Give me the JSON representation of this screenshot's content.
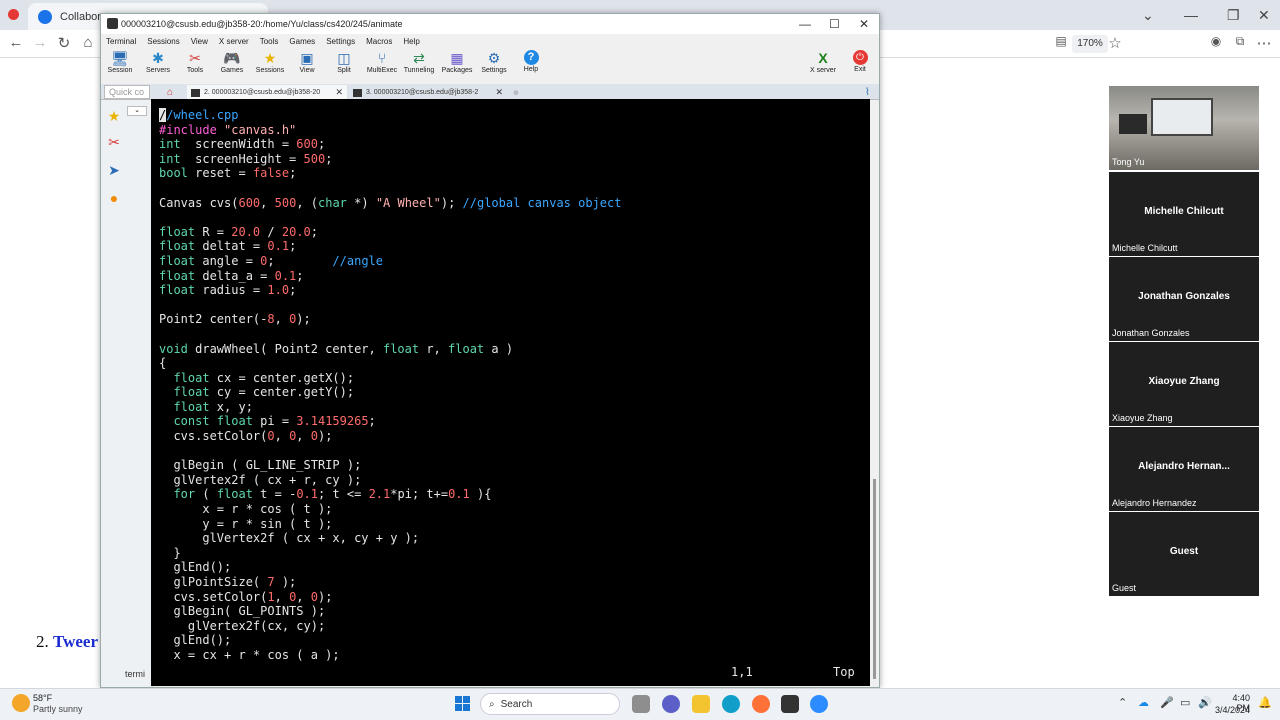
{
  "browser": {
    "tab_label": "Collaborate",
    "zoom": "170%"
  },
  "webpage": {
    "tween_number": "2.",
    "tween_text": "Tweer"
  },
  "participants": {
    "video_name": "Tong Yu",
    "list": [
      {
        "display": "Michelle Chilcutt",
        "label": "Michelle Chilcutt"
      },
      {
        "display": "Jonathan Gonzales",
        "label": "Jonathan Gonzales"
      },
      {
        "display": "Xiaoyue Zhang",
        "label": "Xiaoyue Zhang"
      },
      {
        "display": "Alejandro  Hernan...",
        "label": "Alejandro Hernandez"
      },
      {
        "display": "Guest",
        "label": "Guest"
      }
    ]
  },
  "moba": {
    "title": "000003210@csusb.edu@jb358-20:/home/Yu/class/cs420/245/animate",
    "menu": [
      "Terminal",
      "Sessions",
      "View",
      "X server",
      "Tools",
      "Games",
      "Settings",
      "Macros",
      "Help"
    ],
    "tools": [
      {
        "label": "Session",
        "icon": "session-icon",
        "glyph": "🖥"
      },
      {
        "label": "Servers",
        "icon": "servers-icon",
        "glyph": "✱"
      },
      {
        "label": "Tools",
        "icon": "tools-icon",
        "glyph": "✂"
      },
      {
        "label": "Games",
        "icon": "games-icon",
        "glyph": "🎮"
      },
      {
        "label": "Sessions",
        "icon": "sessions-star-icon",
        "glyph": "★"
      },
      {
        "label": "View",
        "icon": "view-icon",
        "glyph": "▣"
      },
      {
        "label": "Split",
        "icon": "split-icon",
        "glyph": "◫"
      },
      {
        "label": "MultiExec",
        "icon": "multiexec-icon",
        "glyph": "⑂"
      },
      {
        "label": "Tunneling",
        "icon": "tunneling-icon",
        "glyph": "⇄"
      },
      {
        "label": "Packages",
        "icon": "packages-icon",
        "glyph": "▦"
      },
      {
        "label": "Settings",
        "icon": "settings-icon",
        "glyph": "⚙"
      },
      {
        "label": "Help",
        "icon": "help-icon",
        "glyph": "?"
      }
    ],
    "xserver_label": "X server",
    "exit_label": "Exit",
    "quick_connect": "Quick co",
    "tab1": "2. 000003210@csusb.edu@jb358-20",
    "tab2": "3. 000003210@csusb.edu@jb358-2",
    "side_label": "termi",
    "status_pos": "1,1",
    "status_top": "Top"
  },
  "code_lines": [
    [
      [
        "cur",
        "/"
      ],
      [
        "cm",
        "/wheel.cpp"
      ]
    ],
    [
      [
        "pp",
        "#include "
      ],
      [
        "str",
        "\"canvas.h\""
      ]
    ],
    [
      [
        "kw",
        "int"
      ],
      [
        "",
        "  screenWidth = "
      ],
      [
        "num",
        "600"
      ],
      [
        "",
        ";"
      ]
    ],
    [
      [
        "kw",
        "int"
      ],
      [
        "",
        "  screenHeight = "
      ],
      [
        "num",
        "500"
      ],
      [
        "",
        ";"
      ]
    ],
    [
      [
        "kw",
        "bool"
      ],
      [
        "",
        " reset = "
      ],
      [
        "num",
        "false"
      ],
      [
        "",
        ";"
      ]
    ],
    [],
    [
      [
        "",
        "Canvas cvs("
      ],
      [
        "num",
        "600"
      ],
      [
        "",
        ", "
      ],
      [
        "num",
        "500"
      ],
      [
        "",
        ", ("
      ],
      [
        "kw",
        "char"
      ],
      [
        "",
        " *) "
      ],
      [
        "str",
        "\"A Wheel\""
      ],
      [
        "",
        "); "
      ],
      [
        "cm",
        "//global canvas object"
      ]
    ],
    [],
    [
      [
        "kw",
        "float"
      ],
      [
        "",
        " R = "
      ],
      [
        "num",
        "20.0"
      ],
      [
        "",
        " / "
      ],
      [
        "num",
        "20.0"
      ],
      [
        "",
        ";"
      ]
    ],
    [
      [
        "kw",
        "float"
      ],
      [
        "",
        " deltat = "
      ],
      [
        "num",
        "0.1"
      ],
      [
        "",
        ";"
      ]
    ],
    [
      [
        "kw",
        "float"
      ],
      [
        "",
        " angle = "
      ],
      [
        "num",
        "0"
      ],
      [
        "",
        ";        "
      ],
      [
        "cm",
        "//angle"
      ]
    ],
    [
      [
        "kw",
        "float"
      ],
      [
        "",
        " delta_a = "
      ],
      [
        "num",
        "0.1"
      ],
      [
        "",
        ";"
      ]
    ],
    [
      [
        "kw",
        "float"
      ],
      [
        "",
        " radius = "
      ],
      [
        "num",
        "1.0"
      ],
      [
        "",
        ";"
      ]
    ],
    [],
    [
      [
        "",
        "Point2 center(-"
      ],
      [
        "num",
        "8"
      ],
      [
        "",
        ", "
      ],
      [
        "num",
        "0"
      ],
      [
        "",
        ");"
      ]
    ],
    [],
    [
      [
        "kw",
        "void"
      ],
      [
        "",
        " drawWheel( Point2 center, "
      ],
      [
        "kw",
        "float"
      ],
      [
        "",
        " r, "
      ],
      [
        "kw",
        "float"
      ],
      [
        "",
        " a )"
      ]
    ],
    [
      [
        "",
        "{"
      ]
    ],
    [
      [
        "",
        "  "
      ],
      [
        "kw",
        "float"
      ],
      [
        "",
        " cx = center.getX();"
      ]
    ],
    [
      [
        "",
        "  "
      ],
      [
        "kw",
        "float"
      ],
      [
        "",
        " cy = center.getY();"
      ]
    ],
    [
      [
        "",
        "  "
      ],
      [
        "kw",
        "float"
      ],
      [
        "",
        " x, y;"
      ]
    ],
    [
      [
        "",
        "  "
      ],
      [
        "kw",
        "const float"
      ],
      [
        "",
        " pi = "
      ],
      [
        "num",
        "3.14159265"
      ],
      [
        "",
        ";"
      ]
    ],
    [
      [
        "",
        "  cvs.setColor("
      ],
      [
        "num",
        "0"
      ],
      [
        "",
        ", "
      ],
      [
        "num",
        "0"
      ],
      [
        "",
        ", "
      ],
      [
        "num",
        "0"
      ],
      [
        "",
        ");"
      ]
    ],
    [],
    [
      [
        "",
        "  glBegin ( GL_LINE_STRIP );"
      ]
    ],
    [
      [
        "",
        "  glVertex2f ( cx + r, cy );"
      ]
    ],
    [
      [
        "",
        "  "
      ],
      [
        "kw",
        "for"
      ],
      [
        "",
        " ( "
      ],
      [
        "kw",
        "float"
      ],
      [
        "",
        " t = -"
      ],
      [
        "num",
        "0.1"
      ],
      [
        "",
        "; t <= "
      ],
      [
        "num",
        "2.1"
      ],
      [
        "",
        "*pi; t+="
      ],
      [
        "num",
        "0.1"
      ],
      [
        "",
        " ){"
      ]
    ],
    [
      [
        "",
        "      x = r * cos ( t );"
      ]
    ],
    [
      [
        "",
        "      y = r * sin ( t );"
      ]
    ],
    [
      [
        "",
        "      glVertex2f ( cx + x, cy + y );"
      ]
    ],
    [
      [
        "",
        "  }"
      ]
    ],
    [
      [
        "",
        "  glEnd();"
      ]
    ],
    [
      [
        "",
        "  glPointSize( "
      ],
      [
        "num",
        "7"
      ],
      [
        "",
        " );"
      ]
    ],
    [
      [
        "",
        "  cvs.setColor("
      ],
      [
        "num",
        "1"
      ],
      [
        "",
        ", "
      ],
      [
        "num",
        "0"
      ],
      [
        "",
        ", "
      ],
      [
        "num",
        "0"
      ],
      [
        "",
        ");"
      ]
    ],
    [
      [
        "",
        "  glBegin( GL_POINTS );"
      ]
    ],
    [
      [
        "",
        "    glVertex2f(cx, cy);"
      ]
    ],
    [
      [
        "",
        "  glEnd();"
      ]
    ],
    [
      [
        "",
        "  x = cx + r * cos ( a );"
      ]
    ]
  ],
  "taskbar": {
    "temp": "58°F",
    "weather": "Partly sunny",
    "search": "Search",
    "time": "4:40 PM",
    "date": "3/4/2024"
  }
}
